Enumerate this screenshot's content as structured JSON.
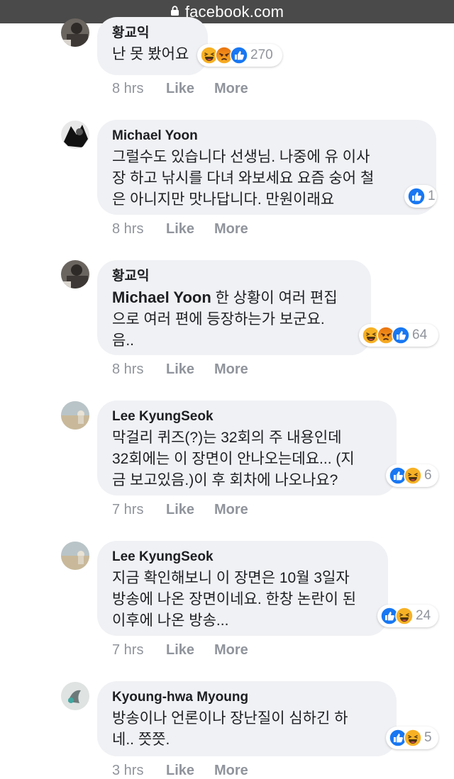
{
  "browser": {
    "url": "facebook.com"
  },
  "comments": [
    {
      "author": "황교익",
      "text": "난 못 봤어요",
      "mention": "",
      "time": "8 hrs",
      "like": "Like",
      "more": "More",
      "reactions": [
        "haha",
        "angry",
        "like"
      ],
      "reaction_count": "270"
    },
    {
      "author": "Michael Yoon",
      "text": "그럴수도 있습니다 선생님. 나중에 유 이사\n장 하고 낚시를 다녀 와보세요 요즘 숭어 철\n은 아니지만 맛나답니다. 만원이래요",
      "mention": "",
      "time": "8 hrs",
      "like": "Like",
      "more": "More",
      "reactions": [
        "like"
      ],
      "reaction_count": "1"
    },
    {
      "author": "황교익",
      "mention": "Michael Yoon",
      "text": " 한 상황이 여러 편집\n으로 여러 편에 등장하는가 보군요.\n음..",
      "time": "8 hrs",
      "like": "Like",
      "more": "More",
      "reactions": [
        "haha",
        "angry",
        "like"
      ],
      "reaction_count": "64"
    },
    {
      "author": "Lee KyungSeok",
      "text": "막걸리 퀴즈(?)는 32회의 주 내용인데\n32회에는 이 장면이 안나오는데요... (지\n금 보고있음.)이 후 회차에 나오나요?",
      "mention": "",
      "time": "7 hrs",
      "like": "Like",
      "more": "More",
      "reactions": [
        "like",
        "haha"
      ],
      "reaction_count": "6"
    },
    {
      "author": "Lee KyungSeok",
      "text": "지금 확인해보니 이 장면은 10월 3일자\n방송에 나온 장면이네요. 한창 논란이 된\n이후에 나온 방송...",
      "mention": "",
      "time": "7 hrs",
      "like": "Like",
      "more": "More",
      "reactions": [
        "like",
        "haha"
      ],
      "reaction_count": "24"
    },
    {
      "author": "Kyoung-hwa Myoung",
      "text": "방송이나 언론이나 장난질이 심하긴 하\n네.. 쯧쯧.",
      "mention": "",
      "time": "3 hrs",
      "like": "Like",
      "more": "More",
      "reactions": [
        "like",
        "haha"
      ],
      "reaction_count": "5"
    }
  ],
  "colors": {
    "bubble": "#f0f1f4",
    "meta": "#90949c",
    "like_blue": "#1877f2",
    "haha_yellow": "#f7b125",
    "angry_orange": "#e9710f"
  }
}
